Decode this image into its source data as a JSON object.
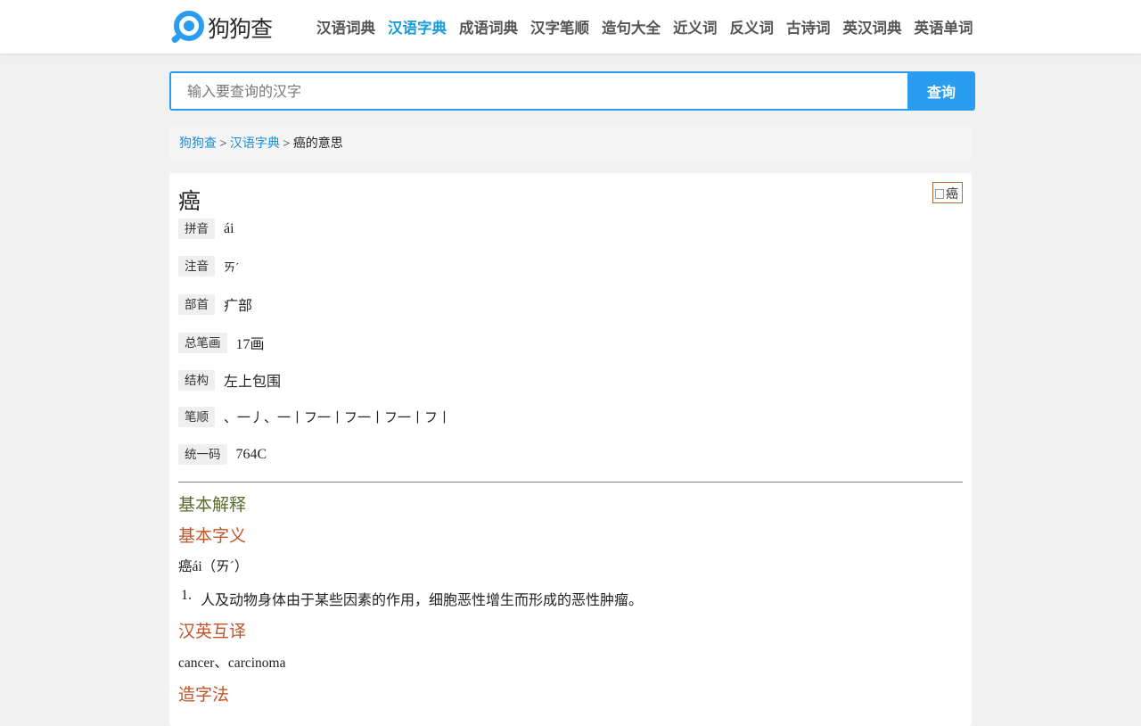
{
  "header": {
    "logo_text": "狗狗查",
    "nav": [
      {
        "label": "汉语词典",
        "active": false
      },
      {
        "label": "汉语字典",
        "active": true
      },
      {
        "label": "成语词典",
        "active": false
      },
      {
        "label": "汉字笔顺",
        "active": false
      },
      {
        "label": "造句大全",
        "active": false
      },
      {
        "label": "近义词",
        "active": false
      },
      {
        "label": "反义词",
        "active": false
      },
      {
        "label": "古诗词",
        "active": false
      },
      {
        "label": "英汉词典",
        "active": false
      },
      {
        "label": "英语单词",
        "active": false
      }
    ]
  },
  "search": {
    "placeholder": "输入要查询的汉字",
    "value": "",
    "button_label": "查询"
  },
  "breadcrumb": {
    "home": "狗狗查",
    "sep1": " > ",
    "section": "汉语字典",
    "sep2": " > ",
    "current": "癌的意思"
  },
  "entry": {
    "character": "癌",
    "image_alt": "癌",
    "attributes": [
      {
        "label": "拼音",
        "value": "ái"
      },
      {
        "label": "注音",
        "value": "ㄞˊ"
      },
      {
        "label": "部首",
        "value": "疒部"
      },
      {
        "label": "总笔画",
        "value": "17画"
      },
      {
        "label": "结构",
        "value": "左上包围"
      },
      {
        "label": "笔顺",
        "value": "、一丿、一丨フ一丨フ一丨フ一丨フ丨"
      },
      {
        "label": "统一码",
        "value": "764C"
      }
    ],
    "basic_explanation_title": "基本解释",
    "basic_meaning_title": "基本字义",
    "pronunciation_line": "癌ái（ㄞˊ）",
    "definitions": [
      {
        "num": "1.",
        "text": "人及动物身体由于某些因素的作用，细胞恶性增生而形成的恶性肿瘤。"
      }
    ],
    "translation_title": "汉英互译",
    "translation": "cancer、carcinoma",
    "formation_title": "造字法"
  },
  "colors": {
    "accent": "#2a9df0",
    "nav_active": "#1a9bdc",
    "section_green": "#5a6b2f",
    "section_orange": "#c0542a"
  }
}
